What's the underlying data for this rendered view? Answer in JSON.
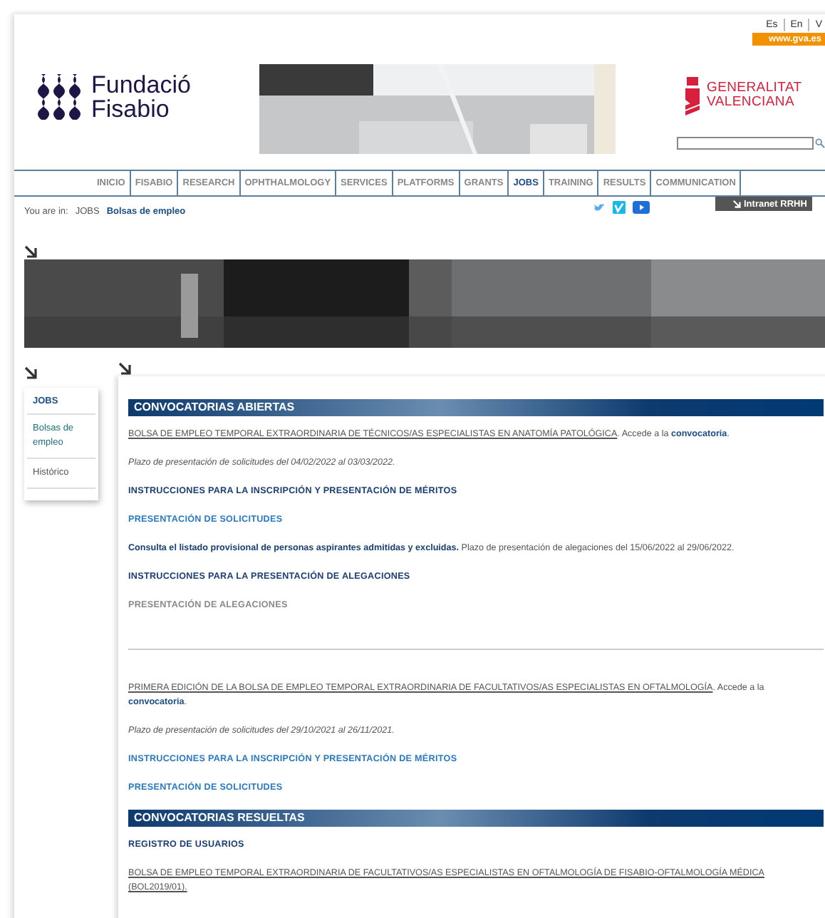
{
  "languages": [
    "Es",
    "En",
    "V"
  ],
  "gva_link": "www.gva.es",
  "logo": {
    "line1": "Fundació",
    "line2": "Fisabio"
  },
  "gva_logo": {
    "line1": "GENERALITAT",
    "line2": "VALENCIANA"
  },
  "nav": [
    {
      "label": "INICIO",
      "selected": false
    },
    {
      "label": "FISABIO",
      "selected": false
    },
    {
      "label": "RESEARCH",
      "selected": false
    },
    {
      "label": "OPHTHALMOLOGY",
      "selected": false
    },
    {
      "label": "SERVICES",
      "selected": false
    },
    {
      "label": "PLATFORMS",
      "selected": false
    },
    {
      "label": "GRANTS",
      "selected": false
    },
    {
      "label": "JOBS",
      "selected": true
    },
    {
      "label": "TRAINING",
      "selected": false
    },
    {
      "label": "RESULTS",
      "selected": false
    },
    {
      "label": "COMMUNICATION",
      "selected": false
    }
  ],
  "breadcrumb": {
    "prefix": "You are in:",
    "items": [
      "JOBS",
      "Bolsas de empleo"
    ]
  },
  "intranet": "Intranet RRHH",
  "sidebar": {
    "title": "JOBS",
    "items": [
      {
        "label": "Bolsas de empleo",
        "selected": true
      },
      {
        "label": "Histórico",
        "selected": false
      }
    ]
  },
  "sections": [
    {
      "heading": "CONVOCATORIAS ABIERTAS",
      "blocks": [
        [
          {
            "kind": "notice",
            "title": "BOLSA DE EMPLEO TEMPORAL EXTRAORDINARIA DE TÉCNICOS/AS ESPECIALISTAS EN ANATOMÍA PATOLÓGICA",
            "lead": ". Accede a la ",
            "link": "convocatoria",
            "trail": "."
          },
          {
            "kind": "dates",
            "text": "Plazo de presentación de solicitudes del 04/02/2022 al 03/03/2022."
          },
          {
            "kind": "link",
            "text": "INSTRUCCIONES PARA LA INSCRIPCIÓN Y PRESENTACIÓN DE MÉRITOS",
            "visited": true,
            "disabled": false
          },
          {
            "kind": "link",
            "text": "PRESENTACIÓN DE SOLICITUDES",
            "visited": false,
            "disabled": false
          },
          {
            "kind": "consult",
            "link": "Consulta el listado provisional de personas aspirantes admitidas y excluidas.",
            "text": " Plazo de presentación de alegaciones del 15/06/2022 al 29/06/2022."
          },
          {
            "kind": "link",
            "text": "INSTRUCCIONES PARA LA PRESENTACIÓN DE ALEGACIONES",
            "visited": true,
            "disabled": false
          },
          {
            "kind": "link",
            "text": "PRESENTACIÓN DE ALEGACIONES",
            "visited": false,
            "disabled": true
          }
        ],
        [
          {
            "kind": "notice",
            "title": "PRIMERA EDICIÓN DE LA BOLSA DE EMPLEO TEMPORAL EXTRAORDINARIA DE FACULTATIVOS/AS ESPECIALISTAS EN OFTALMOLOGÍA",
            "lead": ". Accede a la ",
            "link": "convocatoria",
            "trail": "."
          },
          {
            "kind": "dates",
            "text": "Plazo de presentación de solicitudes del 29/10/2021 al 26/11/2021."
          },
          {
            "kind": "link",
            "text": "INSTRUCCIONES PARA LA INSCRIPCIÓN Y PRESENTACIÓN DE MÉRITOS",
            "visited": false,
            "disabled": false
          },
          {
            "kind": "link",
            "text": "PRESENTACIÓN DE SOLICITUDES",
            "visited": false,
            "disabled": false
          }
        ]
      ]
    },
    {
      "heading": "CONVOCATORIAS RESUELTAS",
      "blocks": [
        [
          {
            "kind": "link",
            "text": "REGISTRO DE USUARIOS",
            "visited": true,
            "disabled": false
          },
          {
            "kind": "notice",
            "title": "BOLSA DE EMPLEO TEMPORAL EXTRAORDINARIA DE FACULTATIVOS/AS ESPECIALISTAS EN OFTALMOLOGÍA DE FISABIO-OFTALMOLOGÍA MÉDICA (BOL2019/01)."
          }
        ]
      ]
    }
  ]
}
